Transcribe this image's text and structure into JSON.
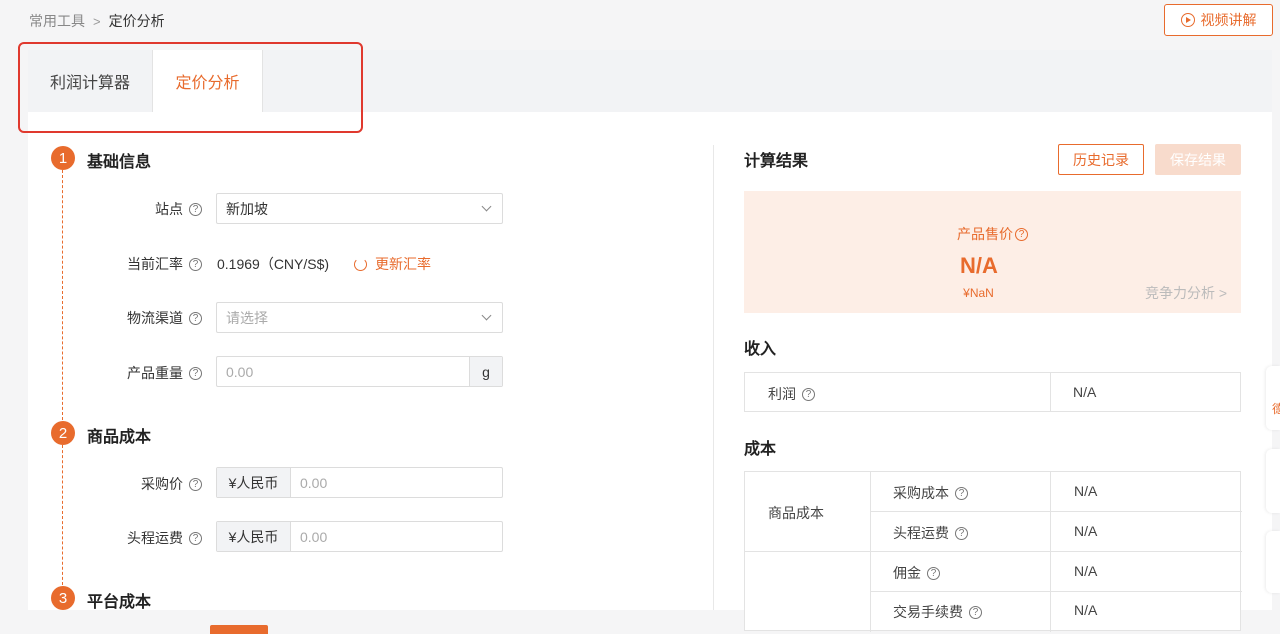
{
  "breadcrumb": {
    "parent": "常用工具",
    "separator": ">",
    "current": "定价分析"
  },
  "video_button": {
    "label": "视频讲解"
  },
  "tabs": [
    {
      "label": "利润计算器"
    },
    {
      "label": "定价分析"
    }
  ],
  "sections": [
    {
      "number": "1",
      "title": "基础信息"
    },
    {
      "number": "2",
      "title": "商品成本"
    },
    {
      "number": "3",
      "title": "平台成本"
    }
  ],
  "fields": {
    "site": {
      "label": "站点",
      "value": "新加坡"
    },
    "rate": {
      "label": "当前汇率",
      "value": "0.1969（CNY/S$)",
      "update_label": "更新汇率"
    },
    "channel": {
      "label": "物流渠道",
      "placeholder": "请选择"
    },
    "weight": {
      "label": "产品重量",
      "placeholder": "0.00",
      "suffix": "g"
    },
    "purchase": {
      "label": "采购价",
      "prefix": "¥人民币",
      "placeholder": "0.00"
    },
    "freight": {
      "label": "头程运费",
      "prefix": "¥人民币",
      "placeholder": "0.00"
    }
  },
  "result": {
    "title": "计算结果",
    "history_button": "历史记录",
    "save_button": "保存结果",
    "price_label": "产品售价",
    "price_value": "N/A",
    "price_cny": "¥NaN",
    "competitiveness_link": "竞争力分析 >"
  },
  "income": {
    "title": "收入",
    "rows": [
      {
        "label": "利润",
        "value": "N/A"
      }
    ]
  },
  "cost": {
    "title": "成本",
    "group_label": "商品成本",
    "rows": [
      {
        "label": "采购成本",
        "value": "N/A"
      },
      {
        "label": "头程运费",
        "value": "N/A"
      },
      {
        "label": "佣金",
        "value": "N/A"
      },
      {
        "label": "交易手续费",
        "value": "N/A"
      }
    ]
  },
  "side_tab": {
    "label": "德"
  },
  "help_glyph": "?",
  "colors": {
    "accent": "#e86b2d",
    "highlight_border": "#e0392e",
    "price_bg": "#fdeee6"
  }
}
